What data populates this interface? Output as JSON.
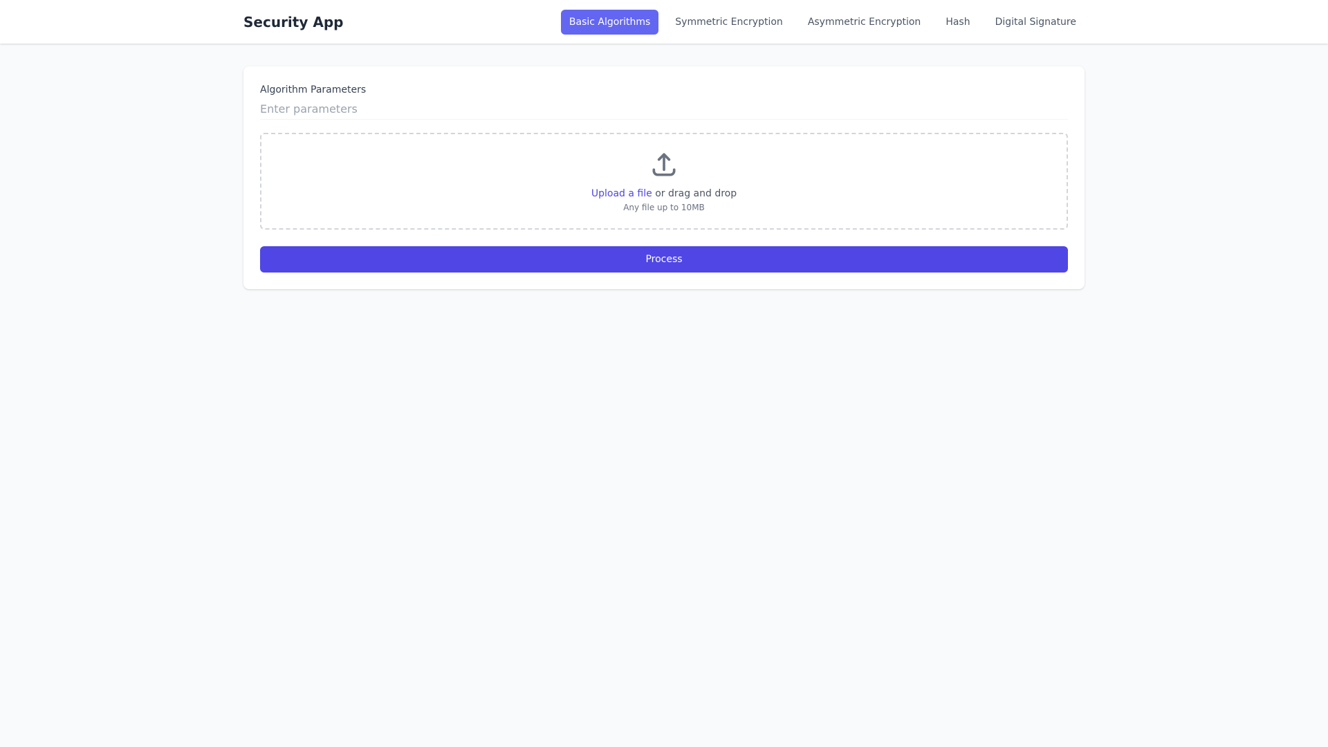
{
  "app": {
    "title": "Security App"
  },
  "nav": {
    "items": [
      {
        "label": "Basic Algorithms",
        "active": true
      },
      {
        "label": "Symmetric Encryption",
        "active": false
      },
      {
        "label": "Asymmetric Encryption",
        "active": false
      },
      {
        "label": "Hash",
        "active": false
      },
      {
        "label": "Digital Signature",
        "active": false
      }
    ]
  },
  "form": {
    "params_label": "Algorithm Parameters",
    "params_value": "",
    "params_placeholder": "Enter parameters",
    "upload": {
      "icon": "upload-icon",
      "link_text": "Upload a file",
      "rest_text": " or drag and drop",
      "hint": "Any file up to 10MB"
    },
    "submit_label": "Process"
  },
  "colors": {
    "accent": "#4f46e5",
    "active_tab": "#6366f1",
    "background": "#f9fafb"
  }
}
